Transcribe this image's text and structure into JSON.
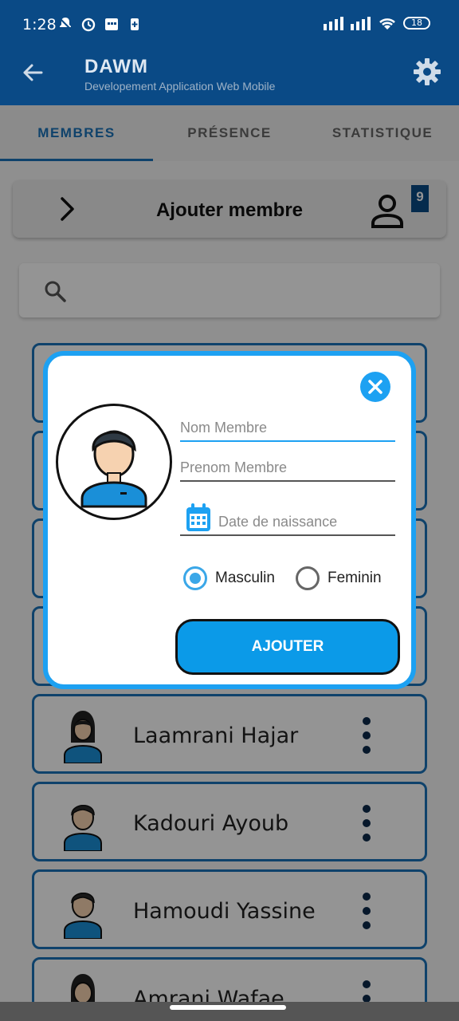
{
  "status_bar": {
    "time": "1:28",
    "battery": "18"
  },
  "app_bar": {
    "title": "DAWM",
    "subtitle": "Developement Application  Web Mobile"
  },
  "tabs": [
    {
      "label": "MEMBRES",
      "active": true
    },
    {
      "label": "PRÉSENCE",
      "active": false
    },
    {
      "label": "STATISTIQUE",
      "active": false
    }
  ],
  "add_member_bar": {
    "label": "Ajouter membre",
    "count_badge": "9"
  },
  "members": [
    {
      "name": "Laamrani Hajar",
      "gender": "female"
    },
    {
      "name": "Kadouri Ayoub",
      "gender": "male"
    },
    {
      "name": "Hamoudi Yassine",
      "gender": "male"
    },
    {
      "name": "Amrani Wafae",
      "gender": "female"
    }
  ],
  "dialog": {
    "nom_placeholder": "Nom Membre",
    "prenom_placeholder": "Prenom Membre",
    "date_placeholder": "Date de naissance",
    "gender_options": [
      "Masculin",
      "Feminin"
    ],
    "selected_gender": "Masculin",
    "submit_label": "AJOUTER"
  },
  "colors": {
    "primary": "#0a4a86",
    "accent": "#1da1f2",
    "button": "#0b9ae8",
    "card_border": "#1a73b8"
  }
}
